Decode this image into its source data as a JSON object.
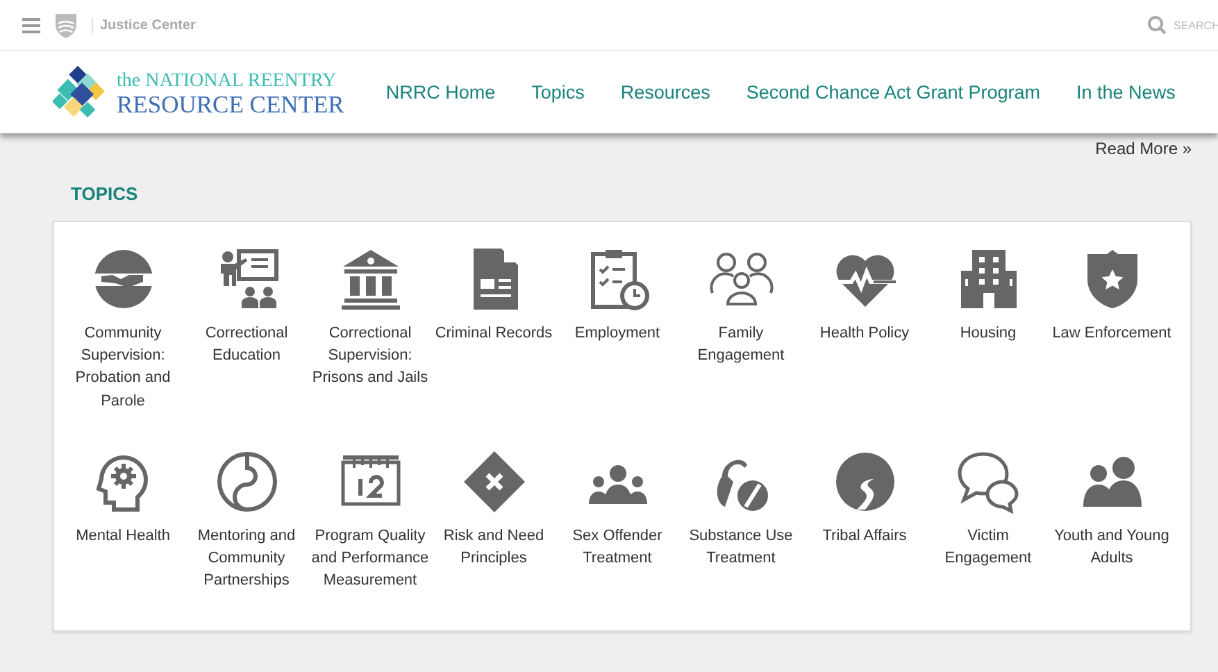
{
  "top_bar": {
    "brand": "Justice Center",
    "search": {
      "placeholder": "SEARCH"
    }
  },
  "header": {
    "logo": {
      "line_1": "the NATIONAL REENTRY",
      "line_2": "RESOURCE CENTER"
    },
    "nav": [
      {
        "label": "NRRC Home"
      },
      {
        "label": "Topics"
      },
      {
        "label": "Resources"
      },
      {
        "label": "Second Chance Act Grant Program"
      },
      {
        "label": "In the News"
      }
    ]
  },
  "read_more": "Read More »",
  "topics": {
    "heading": "TOPICS",
    "items": [
      {
        "label": "Community Supervision: Probation and Parole"
      },
      {
        "label": "Correctional Education"
      },
      {
        "label": "Correctional Supervision: Prisons and Jails"
      },
      {
        "label": "Criminal Records"
      },
      {
        "label": "Employment"
      },
      {
        "label": "Family Engagement"
      },
      {
        "label": "Health Policy"
      },
      {
        "label": "Housing"
      },
      {
        "label": "Law Enforcement"
      },
      {
        "label": "Mental Health"
      },
      {
        "label": "Mentoring and Community Partnerships"
      },
      {
        "label": "Program Quality and Performance Measurement"
      },
      {
        "label": "Risk and Need Principles"
      },
      {
        "label": "Sex Offender Treatment"
      },
      {
        "label": "Substance Use Treatment"
      },
      {
        "label": "Tribal Affairs"
      },
      {
        "label": "Victim Engagement"
      },
      {
        "label": "Youth and Young Adults"
      }
    ]
  }
}
